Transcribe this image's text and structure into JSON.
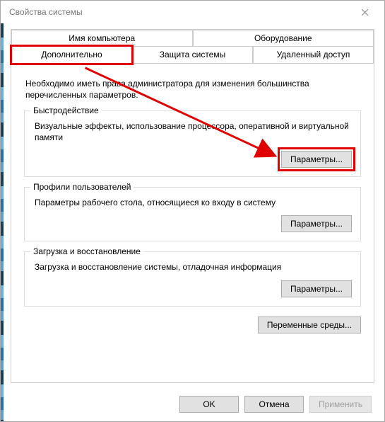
{
  "window": {
    "title": "Свойства системы"
  },
  "tabs": {
    "row1": [
      {
        "label": "Имя компьютера"
      },
      {
        "label": "Оборудование"
      }
    ],
    "row2": [
      {
        "label": "Дополнительно",
        "active": true
      },
      {
        "label": "Защита системы"
      },
      {
        "label": "Удаленный доступ"
      }
    ]
  },
  "intro": "Необходимо иметь права администратора для изменения большинства перечисленных параметров.",
  "groups": {
    "performance": {
      "title": "Быстродействие",
      "desc": "Визуальные эффекты, использование процессора, оперативной и виртуальной памяти",
      "button": "Параметры..."
    },
    "profiles": {
      "title": "Профили пользователей",
      "desc": "Параметры рабочего стола, относящиеся ко входу в систему",
      "button": "Параметры..."
    },
    "startup": {
      "title": "Загрузка и восстановление",
      "desc": "Загрузка и восстановление системы, отладочная информация",
      "button": "Параметры..."
    }
  },
  "env_button": "Переменные среды...",
  "buttons": {
    "ok": "OK",
    "cancel": "Отмена",
    "apply": "Применить"
  }
}
